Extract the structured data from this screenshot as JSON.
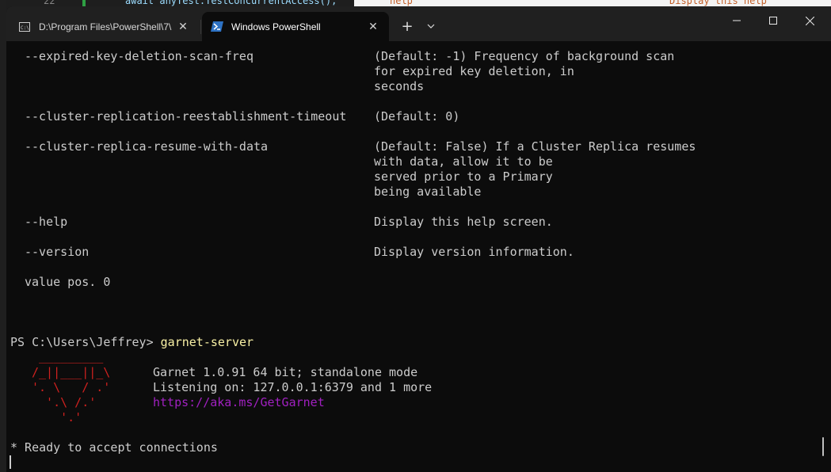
{
  "background": {
    "line_number": "22",
    "code": "await anyTest.TestConcurrentAccess();",
    "right_text_1": "help",
    "right_text_2": "Display this help"
  },
  "window": {
    "tabs": [
      {
        "label": "D:\\Program Files\\PowerShell\\7\\",
        "icon": "console-icon",
        "active": false
      },
      {
        "label": "Windows PowerShell",
        "icon": "powershell-icon",
        "active": true
      }
    ],
    "new_tab_label": "+",
    "controls": {
      "minimize": "—",
      "maximize": "☐",
      "close": "✕"
    }
  },
  "terminal": {
    "options": [
      {
        "flag": "--expired-key-deletion-scan-freq",
        "desc": [
          "(Default: -1) Frequency of background scan",
          "for expired key deletion, in",
          "seconds"
        ]
      },
      {
        "flag": "--cluster-replication-reestablishment-timeout",
        "desc": [
          "(Default: 0)"
        ]
      },
      {
        "flag": "--cluster-replica-resume-with-data",
        "desc": [
          "(Default: False) If a Cluster Replica resumes",
          "with data, allow it to be",
          "served prior to a Primary",
          "being available"
        ]
      },
      {
        "flag": "--help",
        "desc": [
          "Display this help screen."
        ]
      },
      {
        "flag": "--version",
        "desc": [
          "Display version information."
        ]
      }
    ],
    "value_pos": "value pos. 0",
    "prompt": "PS C:\\Users\\Jeffrey> ",
    "command": "garnet-server",
    "logo": [
      " _________",
      "/_||___||_\\",
      "'. \\   / .'",
      "  '.\\ /.'",
      "    '.'"
    ],
    "info": [
      "Garnet 1.0.91 64 bit; standalone mode",
      "Listening on: 127.0.0.1:6379 and 1 more"
    ],
    "link": "https://aka.ms/GetGarnet",
    "ready": "* Ready to accept connections"
  },
  "colors": {
    "background": "#0c0c0c",
    "text": "#cccccc",
    "command": "#f9f1a5",
    "logo": "#d0211f",
    "link": "#a020c0"
  }
}
